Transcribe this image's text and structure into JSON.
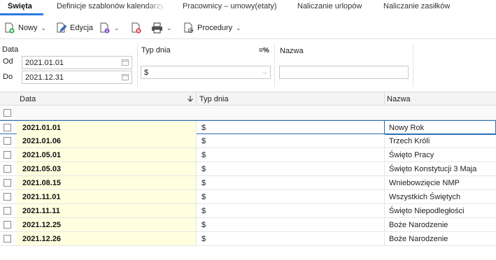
{
  "tabs": [
    {
      "label": "Święta",
      "active": true
    },
    {
      "label": "Definicje szablonów kalendarzy"
    },
    {
      "label": "Pracownicy – umowy(etaty)"
    },
    {
      "label": "Naliczanie urlopów"
    },
    {
      "label": "Naliczanie zasiłków"
    }
  ],
  "toolbar": {
    "new_label": "Nowy",
    "edit_label": "Edycja",
    "procedures_label": "Procedury"
  },
  "filters": {
    "data_label": "Data",
    "od_label": "Od",
    "do_label": "Do",
    "od_value": "2021.01.01",
    "do_value": "2021.12.31",
    "typ_dnia_label": "Typ dnia",
    "typ_dnia_op": "=%",
    "typ_dnia_value": "$",
    "nazwa_label": "Nazwa",
    "nazwa_value": ""
  },
  "grid": {
    "columns": [
      "Data",
      "Typ dnia",
      "Nazwa"
    ],
    "rows": [
      {
        "date": "2021.01.01",
        "typ": "$",
        "name": "Nowy Rok"
      },
      {
        "date": "2021.01.06",
        "typ": "$",
        "name": "Trzech Króli"
      },
      {
        "date": "2021.05.01",
        "typ": "$",
        "name": "Święto Pracy"
      },
      {
        "date": "2021.05.03",
        "typ": "$",
        "name": "Święto Konstytucji 3 Maja"
      },
      {
        "date": "2021.08.15",
        "typ": "$",
        "name": "Wniebowzięcie NMP"
      },
      {
        "date": "2021.11.01",
        "typ": "$",
        "name": "Wszystkich Świętych"
      },
      {
        "date": "2021.11.11",
        "typ": "$",
        "name": "Święto Niepodległości"
      },
      {
        "date": "2021.12.25",
        "typ": "$",
        "name": "Boże Narodzenie"
      },
      {
        "date": "2021.12.26",
        "typ": "$",
        "name": "Boże Narodzenie"
      }
    ]
  },
  "colors": {
    "accent": "#2a7de1",
    "date_cell_bg": "#ffffe0",
    "selection_border": "#2a6db5"
  }
}
